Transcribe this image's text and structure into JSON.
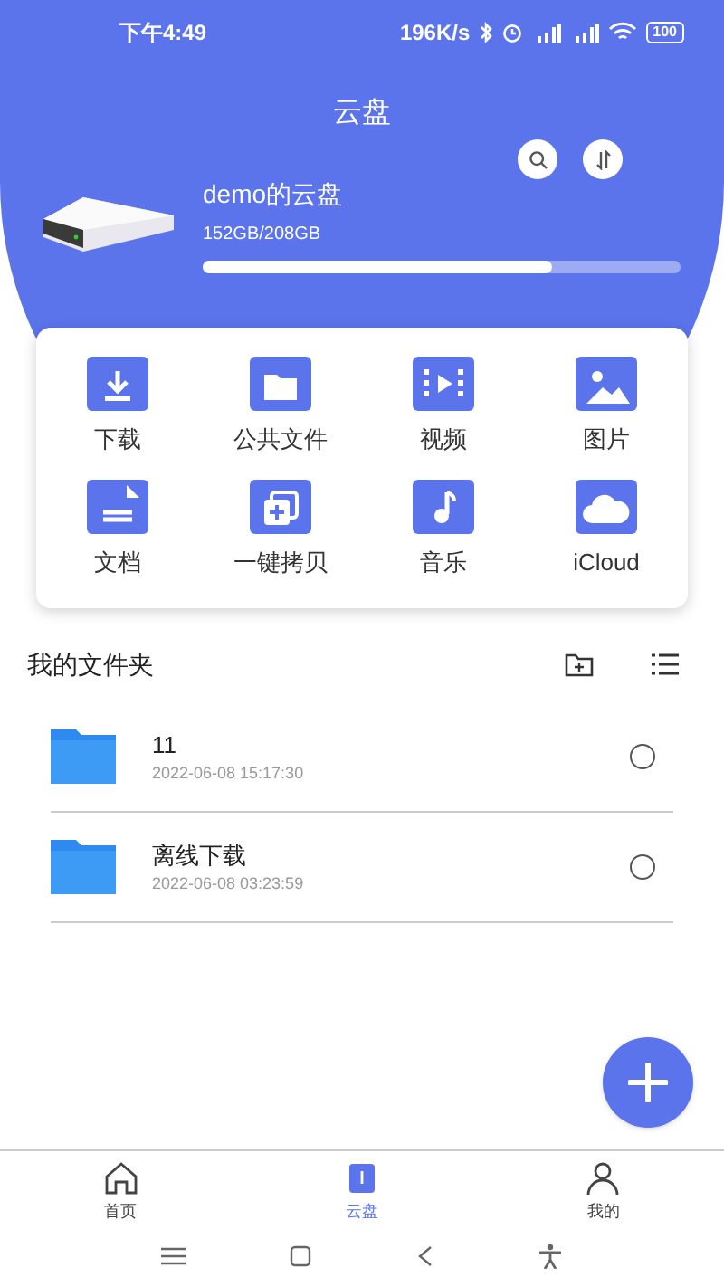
{
  "status_bar": {
    "time": "下午4:49",
    "speed": "196K/s",
    "battery": "100"
  },
  "header": {
    "title": "云盘"
  },
  "drive": {
    "name": "demo的云盘",
    "usage": "152GB/208GB",
    "level": 0.73
  },
  "shortcuts": [
    {
      "label": "下载",
      "kind": "download"
    },
    {
      "label": "公共文件",
      "kind": "folder"
    },
    {
      "label": "视频",
      "kind": "video"
    },
    {
      "label": "图片",
      "kind": "image"
    },
    {
      "label": "文档",
      "kind": "document"
    },
    {
      "label": "一键拷贝",
      "kind": "copy"
    },
    {
      "label": "音乐",
      "kind": "music"
    },
    {
      "label": "iCloud",
      "kind": "cloud"
    }
  ],
  "folders_section": {
    "title": "我的文件夹"
  },
  "folders": [
    {
      "name": "11",
      "date": "2022-06-08 15:17:30",
      "selected": false
    },
    {
      "name": "离线下载",
      "date": "2022-06-08 03:23:59",
      "selected": false
    }
  ],
  "tabs": [
    {
      "label": "首页",
      "kind": "home",
      "selected": false
    },
    {
      "label": "云盘",
      "kind": "drive",
      "selected": true
    },
    {
      "label": "我的",
      "kind": "profile",
      "selected": false
    }
  ]
}
